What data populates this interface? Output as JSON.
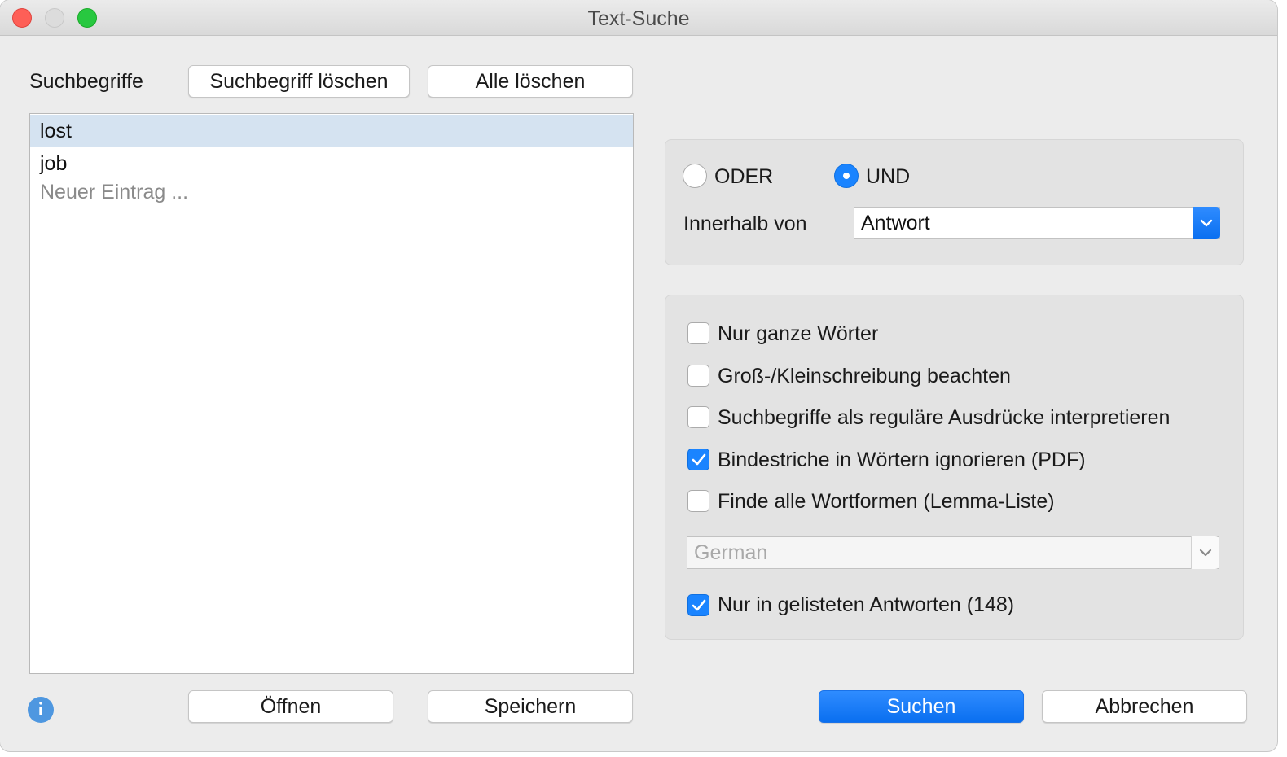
{
  "window": {
    "title": "Text-Suche"
  },
  "search_terms": {
    "label": "Suchbegriffe",
    "delete_term_button": "Suchbegriff löschen",
    "delete_all_button": "Alle löschen",
    "items": [
      "lost",
      "job"
    ],
    "new_entry_placeholder": "Neuer Eintrag ..."
  },
  "logic": {
    "or_label": "ODER",
    "and_label": "UND",
    "selected": "UND",
    "within_label": "Innerhalb von",
    "within_value": "Antwort"
  },
  "options": {
    "whole_words": {
      "label": "Nur ganze Wörter",
      "checked": false
    },
    "case_sensitive": {
      "label": "Groß-/Kleinschreibung beachten",
      "checked": false
    },
    "regex": {
      "label": "Suchbegriffe als reguläre Ausdrücke interpretieren",
      "checked": false
    },
    "ignore_hyphens": {
      "label": "Bindestriche in Wörtern ignorieren (PDF)",
      "checked": true
    },
    "lemma": {
      "label": "Finde alle Wortformen (Lemma-Liste)",
      "checked": false
    },
    "language_value": "German",
    "listed_only": {
      "label": "Nur in gelisteten Antworten (148)",
      "checked": true
    }
  },
  "footer": {
    "open_button": "Öffnen",
    "save_button": "Speichern",
    "search_button": "Suchen",
    "cancel_button": "Abbrechen"
  },
  "colors": {
    "accent": "#1a84ff",
    "selection": "#d5e3f1"
  }
}
